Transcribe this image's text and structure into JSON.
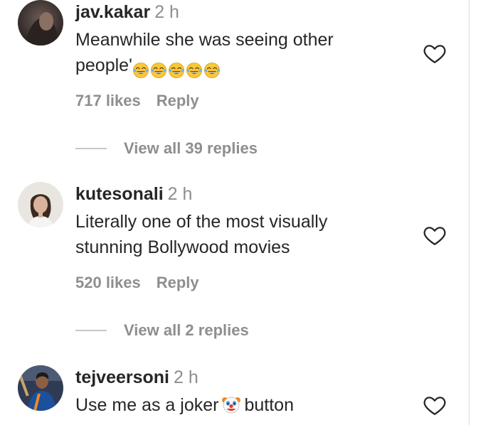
{
  "comments": [
    {
      "username": "jav.kakar",
      "time": "2 h",
      "text_line1": "Meanwhile she was seeing other",
      "text_line2_prefix": "people'",
      "emoji_names": [
        "face-with-tears-of-joy",
        "face-with-tears-of-joy",
        "face-with-tears-of-joy",
        "face-with-tears-of-joy",
        "face-with-tears-of-joy"
      ],
      "likes": "717 likes",
      "reply_label": "Reply",
      "view_replies": "View all 39 replies"
    },
    {
      "username": "kutesonali",
      "time": "2 h",
      "text_line1": "Literally one of the most visually",
      "text_line2": "stunning Bollywood movies",
      "likes": "520 likes",
      "reply_label": "Reply",
      "view_replies": "View all 2 replies"
    },
    {
      "username": "tejveersoni",
      "time": "2 h",
      "text_before_emoji": "Use me as a joker",
      "emoji_name": "clown-face",
      "text_after_emoji": "button"
    }
  ],
  "icons": {
    "like": "heart-outline-icon"
  },
  "colors": {
    "primary_text": "#262626",
    "secondary_text": "#8e8e8e",
    "divider": "#c7c7c7"
  }
}
